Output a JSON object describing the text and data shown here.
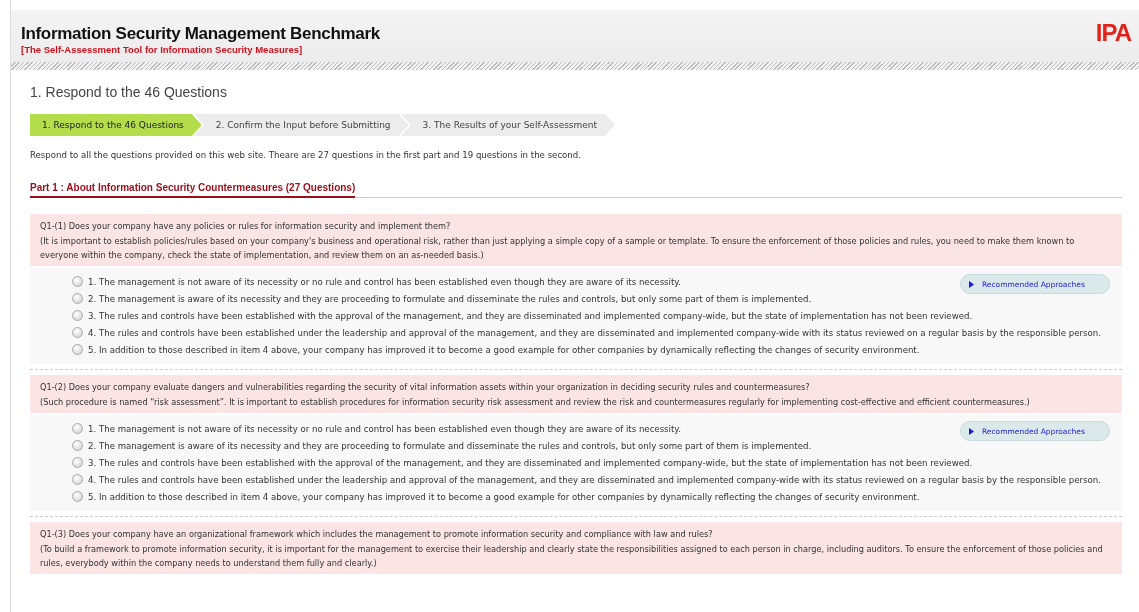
{
  "header": {
    "title": "Information Security Management Benchmark",
    "subtitle": "[The Self-Assessment Tool for Information Security Measures]",
    "logo": "IPA"
  },
  "page_title": "1. Respond to the 46 Questions",
  "steps": [
    {
      "label": "1. Respond to the 46 Questions",
      "selected": true
    },
    {
      "label": "2. Confirm the Input before Submitting",
      "selected": false
    },
    {
      "label": "3. The Results of your Self-Assessment",
      "selected": false
    }
  ],
  "intro": "Respond to all the questions provided on this web site. Theare are 27 questions in the first part and 19 questions in the second.",
  "part_heading": "Part 1 : About Information Security Countermeasures (27 Questions)",
  "questions": [
    {
      "question": "Q1-(1) Does your company have any policies or rules for information security and implement them?",
      "note": "(It is important to establish policies/rules based on your company's business and operational risk, rather than just applying a simple copy of a sample or template. To ensure the enforcement of those policies and rules, you need to make them known to everyone within the company, check the state of implementation, and review them on an as-needed basis.)",
      "button": "Recommended Approaches",
      "answers": [
        {
          "label": "1. The management is not aware of its necessity or no rule and control has been established even though they are aware of its necessity.",
          "selected": false
        },
        {
          "label": "2. The management is aware of its necessity and they are proceeding to formulate and disseminate the rules and controls, but only some part of them is implemented.",
          "selected": false
        },
        {
          "label": "3. The rules and controls have been established with the approval of the management, and they are disseminated and implemented company-wide, but the state of implementation has not been reviewed.",
          "selected": false
        },
        {
          "label": "4. The rules and controls have been established under the leadership and approval of the management, and they are disseminated and implemented company-wide with its status reviewed on a regular basis by the responsible person.",
          "selected": false
        },
        {
          "label": "5. In addition to those described in item 4 above, your company has improved it to become a good example for other companies by dynamically reflecting the changes of security environment.",
          "selected": false
        }
      ]
    },
    {
      "question": "Q1-(2) Does your company evaluate dangers and vulnerabilities regarding the security of vital information assets within your organization in deciding security rules and countermeasures?",
      "note": "(Such procedure is named “risk assessment”. It is important to establish procedures for information security risk assessment and review the risk and countermeasures regularly for implementing cost-effective and efficient countermeasures.)",
      "button": "Recommended Approaches",
      "answers": [
        {
          "label": "1. The management is not aware of its necessity or no rule and control has been established even though they are aware of its necessity.",
          "selected": false
        },
        {
          "label": "2. The management is aware of its necessity and they are proceeding to formulate and disseminate the rules and controls, but only some part of them is implemented.",
          "selected": false
        },
        {
          "label": "3. The rules and controls have been established with the approval of the management, and they are disseminated and implemented company-wide, but the state of implementation has not been reviewed.",
          "selected": false
        },
        {
          "label": "4. The rules and controls have been established under the leadership and approval of the management, and they are disseminated and implemented company-wide with its status reviewed on a regular basis by the responsible person.",
          "selected": false
        },
        {
          "label": "5. In addition to those described in item 4 above, your company has improved it to become a good example for other companies by dynamically reflecting the changes of security environment.",
          "selected": false
        }
      ]
    },
    {
      "question": "Q1-(3) Does your company have an organizational framework which includes the management to promote information security and compliance with law and rules?",
      "note": "(To build a framework to promote information security, it is important for the management to exercise their leadership and clearly state the responsibilities assigned to each person in charge, including auditors. To ensure the enforcement of those policies and rules, everybody within the company needs to understand them fully and clearly.)"
    }
  ]
}
